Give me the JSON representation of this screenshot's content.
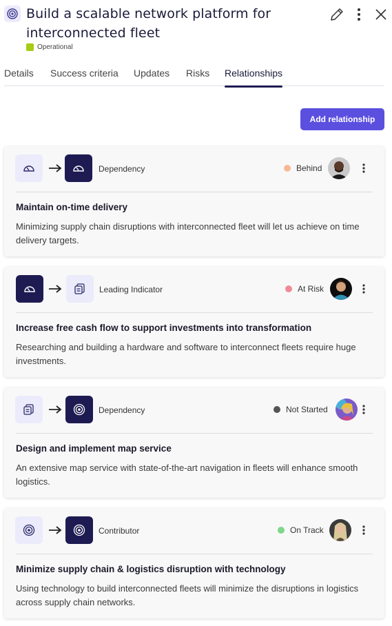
{
  "header": {
    "title": "Build a scalable network platform for interconnected fleet",
    "status": "Operational",
    "status_color": "#a6cc15",
    "icons": [
      "target-icon",
      "edit-icon",
      "more-vertical-icon",
      "close-icon"
    ]
  },
  "tabs": [
    {
      "label": "Details"
    },
    {
      "label": "Success criteria"
    },
    {
      "label": "Updates"
    },
    {
      "label": "Risks"
    },
    {
      "label": "Relationships",
      "active": true
    }
  ],
  "add_button": {
    "label": "Add relationship",
    "color": "#5b4fe0"
  },
  "relationships": [
    {
      "from_icon": "gauge-icon",
      "to_icon": "gauge-icon",
      "type": "Dependency",
      "status": "Behind",
      "status_color": "#f6b995",
      "title": "Maintain on-time delivery",
      "description": "Minimizing supply chain disruptions with interconnected fleet will let us achieve on time delivery targets."
    },
    {
      "from_icon": "gauge-icon",
      "to_icon": "document-icon",
      "type": "Leading Indicator",
      "status": "At Risk",
      "status_color": "#f08a94",
      "title": "Increase free cash flow to support investments into transformation",
      "description": "Researching and building a hardware and software to interconnect fleets require huge investments."
    },
    {
      "from_icon": "document-icon",
      "to_icon": "target-icon",
      "type": "Dependency",
      "status": "Not Started",
      "status_color": "#555555",
      "title": "Design and implement map service",
      "description": "An extensive map service with state-of-the-art navigation in fleets will enhance smooth logistics."
    },
    {
      "from_icon": "target-icon",
      "to_icon": "target-icon",
      "type": "Contributor",
      "status": "On Track",
      "status_color": "#7ed88a",
      "title": "Minimize supply chain & logistics disruption with technology",
      "description": "Using technology to build interconnected fleets will minimize the disruptions in logistics across supply chain networks."
    }
  ]
}
